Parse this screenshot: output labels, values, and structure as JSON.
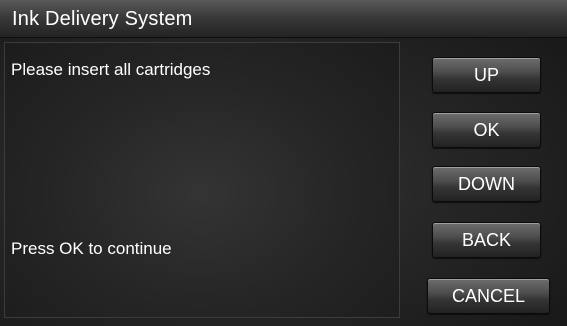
{
  "window": {
    "title": "Ink Delivery System"
  },
  "content": {
    "message_top": "Please insert all cartridges",
    "message_bottom": "Press OK to continue"
  },
  "buttons": {
    "up": "UP",
    "ok": "OK",
    "down": "DOWN",
    "back": "BACK",
    "cancel": "CANCEL"
  },
  "colors": {
    "background": "#1a1a1a",
    "text": "#ffffff",
    "button_face": "#4e4e4e"
  }
}
